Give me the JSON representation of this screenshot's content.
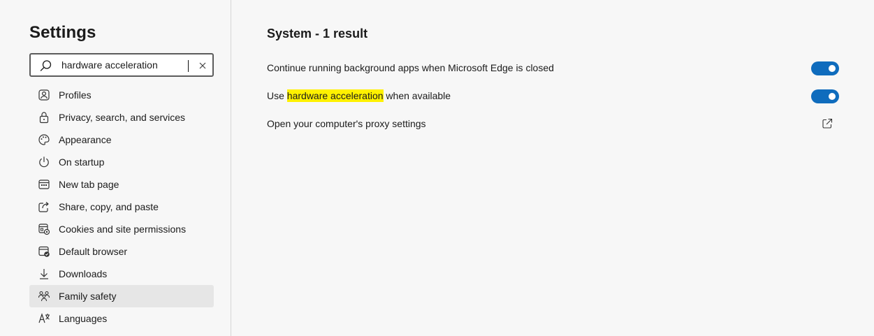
{
  "sidebar": {
    "title": "Settings",
    "search": {
      "value": "hardware acceleration",
      "placeholder": "Search settings"
    },
    "items": [
      {
        "label": "Profiles",
        "icon": "profiles-icon"
      },
      {
        "label": "Privacy, search, and services",
        "icon": "lock-icon"
      },
      {
        "label": "Appearance",
        "icon": "palette-icon"
      },
      {
        "label": "On startup",
        "icon": "power-icon"
      },
      {
        "label": "New tab page",
        "icon": "new-tab-icon"
      },
      {
        "label": "Share, copy, and paste",
        "icon": "share-icon"
      },
      {
        "label": "Cookies and site permissions",
        "icon": "cookies-icon"
      },
      {
        "label": "Default browser",
        "icon": "default-browser-icon"
      },
      {
        "label": "Downloads",
        "icon": "download-icon"
      },
      {
        "label": "Family safety",
        "icon": "family-icon",
        "selected": true
      },
      {
        "label": "Languages",
        "icon": "languages-icon"
      }
    ]
  },
  "main": {
    "section_title": "System - 1 result",
    "rows": [
      {
        "label": "Continue running background apps when Microsoft Edge is closed",
        "control": "toggle",
        "on": true
      },
      {
        "label_before": "Use ",
        "label_highlight": "hardware acceleration",
        "label_after": " when available",
        "control": "toggle",
        "on": true
      },
      {
        "label": "Open your computer's proxy settings",
        "control": "external-link-icon"
      }
    ]
  },
  "colors": {
    "accent": "#0f6cbd",
    "highlight": "#fff100",
    "background": "#f7f7f7",
    "selected": "#e6e6e6"
  }
}
